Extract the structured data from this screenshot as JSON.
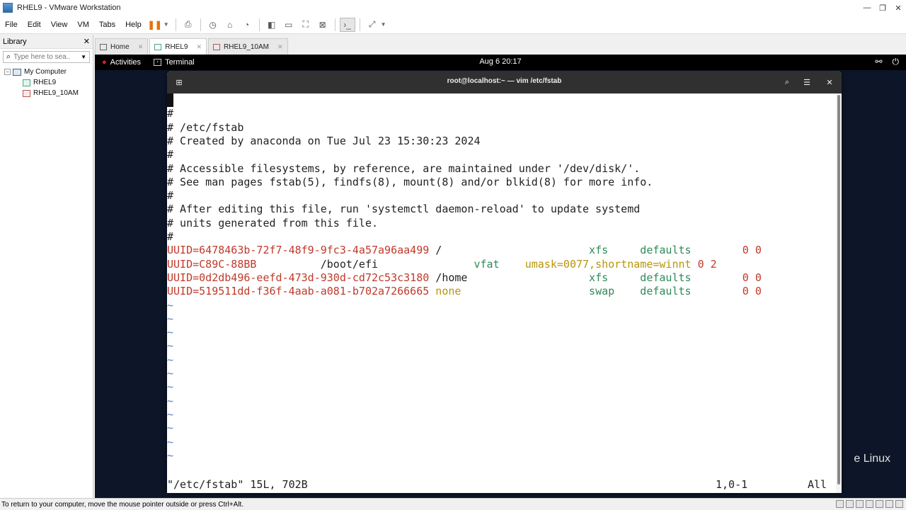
{
  "window": {
    "title": "RHEL9 - VMware Workstation",
    "controls": [
      "—",
      "❐",
      "✕"
    ]
  },
  "menu": [
    "File",
    "Edit",
    "View",
    "VM",
    "Tabs",
    "Help"
  ],
  "library": {
    "title": "Library",
    "close": "✕",
    "search_placeholder": "Type here to sea...",
    "tree": {
      "root": "My Computer",
      "items": [
        "RHEL9",
        "RHEL9_10AM"
      ]
    }
  },
  "tabs": [
    {
      "label": "Home",
      "active": false
    },
    {
      "label": "RHEL9",
      "active": true
    },
    {
      "label": "RHEL9_10AM",
      "active": false
    }
  ],
  "gnome": {
    "activities": "Activities",
    "app": "Terminal",
    "clock": "Aug 6  20:17",
    "brand": "e Linux"
  },
  "terminal": {
    "title": "root@localhost:~ — vim /etc/fstab",
    "lines": [
      "#",
      "# /etc/fstab",
      "# Created by anaconda on Tue Jul 23 15:30:23 2024",
      "#",
      "# Accessible filesystems, by reference, are maintained under '/dev/disk/'.",
      "# See man pages fstab(5), findfs(8), mount(8) and/or blkid(8) for more info.",
      "#",
      "# After editing this file, run 'systemctl daemon-reload' to update systemd",
      "# units generated from this file.",
      "#"
    ],
    "fstab": [
      {
        "uuid": "UUID=6478463b-72f7-48f9-9fc3-4a57a96aa499",
        "mount": " /                       ",
        "type": "xfs     ",
        "opts": "defaults        ",
        "dump": "0 0"
      },
      {
        "uuid": "UUID=C89C-88BB",
        "mount": "          /boot/efi               ",
        "type": "vfat    ",
        "opts": "umask=0077,shortname=winnt",
        "dump": " 0 2"
      },
      {
        "uuid": "UUID=0d2db496-eefd-473d-930d-cd72c53c3180",
        "mount": " /home                   ",
        "type": "xfs     ",
        "opts": "defaults        ",
        "dump": "0 0"
      },
      {
        "uuid": "UUID=519511dd-f36f-4aab-a081-b702a7266665",
        "mount": " none                    ",
        "type": "swap    ",
        "opts": "defaults        ",
        "dump": "0 0"
      }
    ],
    "tilde": "~",
    "status_file": "\"/etc/fstab\" 15L, 702B",
    "status_pos": "1,0-1",
    "status_all": "All"
  },
  "statusbar": "To return to your computer, move the mouse pointer outside or press Ctrl+Alt."
}
